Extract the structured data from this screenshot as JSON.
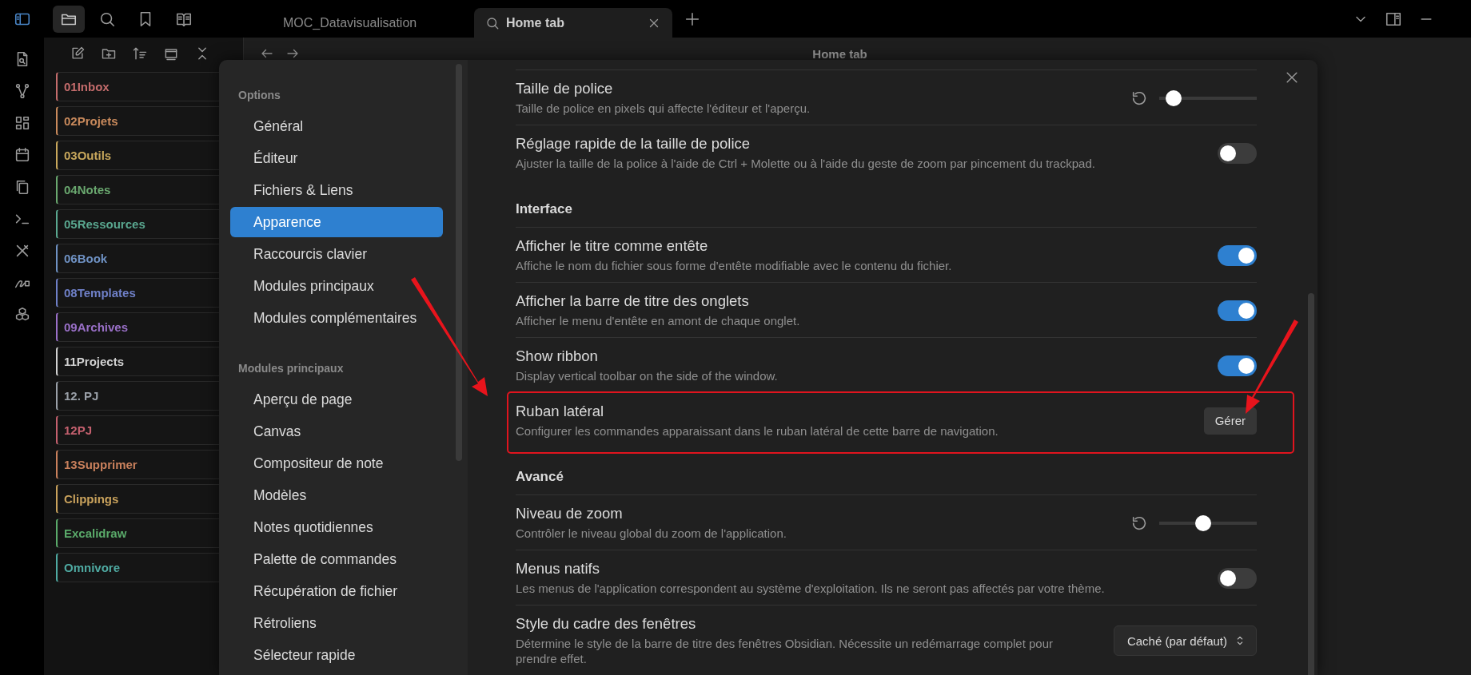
{
  "top_bar": {
    "tabs": [
      {
        "label": "MOC_Datavisualisation",
        "selected": false
      },
      {
        "label": "Home tab",
        "selected": true
      }
    ]
  },
  "file_explorer": {
    "folders": [
      {
        "name": "01Inbox",
        "color": "#c46c6c"
      },
      {
        "name": "02Projets",
        "color": "#c98a5c"
      },
      {
        "name": "03Outils",
        "color": "#c9a85c"
      },
      {
        "name": "04Notes",
        "color": "#6aa86f"
      },
      {
        "name": "05Ressources",
        "color": "#5aa890"
      },
      {
        "name": "06Book",
        "color": "#6f92c4"
      },
      {
        "name": "08Templates",
        "color": "#6f80c8"
      },
      {
        "name": "09Archives",
        "color": "#9a70c8"
      },
      {
        "name": "11Projects",
        "color": "#d2d2d2"
      },
      {
        "name": "12. PJ",
        "color": "#9aa0a8"
      },
      {
        "name": "12PJ",
        "color": "#c4606e"
      },
      {
        "name": "13Supprimer",
        "color": "#c9805c"
      },
      {
        "name": "Clippings",
        "color": "#c9a25c"
      },
      {
        "name": "Excalidraw",
        "color": "#5aaa6a"
      },
      {
        "name": "Omnivore",
        "color": "#4faaa2"
      }
    ]
  },
  "editor": {
    "title": "Home tab"
  },
  "settings": {
    "sidebar": [
      {
        "heading": "Options",
        "items": [
          {
            "label": "Général",
            "selected": false
          },
          {
            "label": "Éditeur",
            "selected": false
          },
          {
            "label": "Fichiers & Liens",
            "selected": false
          },
          {
            "label": "Apparence",
            "selected": true
          },
          {
            "label": "Raccourcis clavier",
            "selected": false
          },
          {
            "label": "Modules principaux",
            "selected": false
          },
          {
            "label": "Modules complémentaires",
            "selected": false
          }
        ]
      },
      {
        "heading": "Modules principaux",
        "items": [
          {
            "label": "Aperçu de page",
            "selected": false
          },
          {
            "label": "Canvas",
            "selected": false
          },
          {
            "label": "Compositeur de note",
            "selected": false
          },
          {
            "label": "Modèles",
            "selected": false
          },
          {
            "label": "Notes quotidiennes",
            "selected": false
          },
          {
            "label": "Palette de commandes",
            "selected": false
          },
          {
            "label": "Récupération de fichier",
            "selected": false
          },
          {
            "label": "Rétroliens",
            "selected": false
          },
          {
            "label": "Sélecteur rapide",
            "selected": false
          }
        ]
      }
    ],
    "sections": [
      {
        "rows": [
          {
            "kind": "slider",
            "title": "Taille de police",
            "description": "Taille de police en pixels qui affecte l'éditeur et l'aperçu.",
            "level": 0.15,
            "highlighted": false
          },
          {
            "kind": "toggle",
            "title": "Réglage rapide de la taille de police",
            "description": "Ajuster la taille de la police à l'aide de Ctrl + Molette ou à l'aide du geste de zoom par pincement du trackpad.",
            "on": false,
            "highlighted": false
          }
        ]
      },
      {
        "heading": "Interface",
        "rows": [
          {
            "kind": "toggle",
            "title": "Afficher le titre comme entête",
            "description": "Affiche le nom du fichier sous forme d'entête modifiable avec le contenu du fichier.",
            "on": true,
            "highlighted": false
          },
          {
            "kind": "toggle",
            "title": "Afficher la barre de titre des onglets",
            "description": "Afficher le menu d'entête en amont de chaque onglet.",
            "on": true,
            "highlighted": false
          },
          {
            "kind": "toggle",
            "title": "Show ribbon",
            "description": "Display vertical toolbar on the side of the window.",
            "on": true,
            "highlighted": false
          },
          {
            "kind": "button",
            "title": "Ruban latéral",
            "description": "Configurer les commandes apparaissant dans le ruban latéral de cette barre de navigation.",
            "button_label": "Gérer",
            "highlighted": true
          }
        ]
      },
      {
        "heading": "Avancé",
        "rows": [
          {
            "kind": "slider",
            "title": "Niveau de zoom",
            "description": "Contrôler le niveau global du zoom de l'application.",
            "level": 0.45,
            "highlighted": false
          },
          {
            "kind": "toggle",
            "title": "Menus natifs",
            "description": "Les menus de l'application correspondent au système d'exploitation. Ils ne seront pas affectés par votre thème.",
            "on": false,
            "highlighted": false
          },
          {
            "kind": "dropdown",
            "title": "Style du cadre des fenêtres",
            "description": "Détermine le style de la barre de titre des fenêtres Obsidian. Nécessite un redémarrage complet pour prendre effet.",
            "value": "Caché (par défaut)",
            "highlighted": false
          }
        ]
      }
    ]
  }
}
